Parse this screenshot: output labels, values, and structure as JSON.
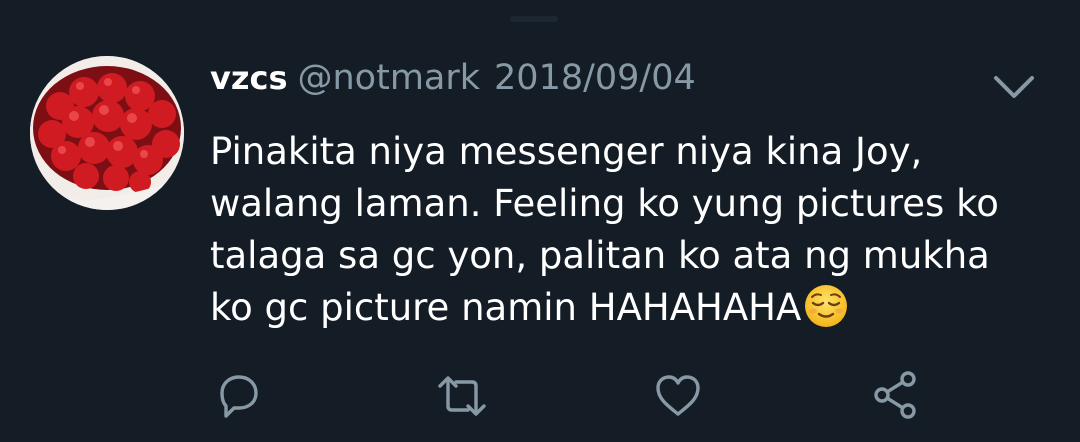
{
  "tweet": {
    "display_name": "vzcs",
    "handle": "@notmark",
    "date": "2018/09/04",
    "text": "Pinakita niya messenger niya kina Joy, walang laman. Feeling ko yung pictures ko talaga sa gc yon, palitan ko ata ng mukha ko gc picture namin HAHAHAHA",
    "emoji": "relieved-face-emoji"
  },
  "icons": {
    "avatar": "strawberry-cake-avatar",
    "menu": "chevron-down-icon",
    "reply": "reply-icon",
    "retweet": "retweet-icon",
    "like": "heart-icon",
    "share": "share-icon"
  },
  "colors": {
    "background": "#141d26",
    "secondary_text": "#8899a6",
    "primary_text": "#ffffff"
  }
}
